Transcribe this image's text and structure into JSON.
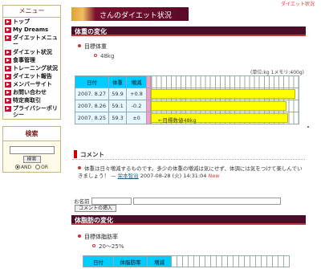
{
  "header": {
    "top_right_link": "ダイエット状況",
    "title": "さんのダイエット状況"
  },
  "sidebar": {
    "menu_title": "メニュー",
    "items": [
      "トップ",
      "My Dreams",
      "ダイエットメニュー",
      "ダイエット状況",
      "食事管理",
      "トレーニング状況",
      "ダイエット報告",
      "メンバーサイト",
      "お問い合わせ",
      "特定商取引",
      "プライバシーポリシー"
    ],
    "search": {
      "title": "検索",
      "button": "検索",
      "and_label": "AND",
      "or_label": "OR",
      "selected": "AND"
    }
  },
  "weight_section": {
    "title": "体重の変化",
    "goal_label": "目標体重",
    "goal_value": "48kg",
    "unit_note": "(単位:kg 1メモリ:400g)",
    "table": {
      "headers": [
        "日付",
        "体重",
        "増減"
      ],
      "rows": [
        {
          "date": "2007. 8.27",
          "weight": "59.9",
          "diff": "+0.8",
          "bar_fraction": 1.0,
          "label": ""
        },
        {
          "date": "2007. 8.26",
          "weight": "59.1",
          "diff": "-0.2",
          "bar_fraction": 0.94,
          "label": ""
        },
        {
          "date": "2007. 8.25",
          "weight": "59.3",
          "diff": "±0",
          "bar_fraction": 0.95,
          "label": "←目標数値48kg"
        }
      ]
    }
  },
  "comment_section": {
    "title": "コメント",
    "text": "体重は日々増減するものです。多少の体重の増減は気にせず、体調には気をつけて楽しんでいきましょう！ —",
    "author": "栄本智治",
    "timestamp": "2007-08-28 (火) 14:31:04",
    "new_badge": "New",
    "name_label": "お名前",
    "post_button": "コメントの挿入"
  },
  "fat_section": {
    "title": "体脂肪の変化",
    "goal_label": "目標体脂肪率",
    "goal_value": "20～25%",
    "table_headers": [
      "日付",
      "体脂肪率",
      "増減"
    ]
  },
  "colors": {
    "section_bar": "#4a0e2a",
    "table_header": "#00ccff",
    "bar_fill": "#ffff00",
    "menu_arrow": "#c8102e"
  }
}
